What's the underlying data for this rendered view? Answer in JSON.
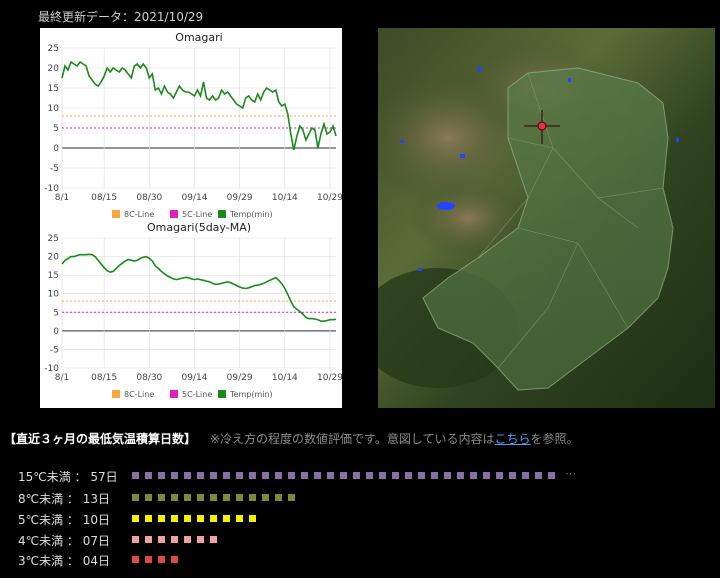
{
  "header": {
    "last_update": "最終更新データ：2021/10/29"
  },
  "colors": {
    "line_8c": "#f5a742",
    "line_5c": "#e020c0",
    "temp": "#1a8a1a",
    "axis_zero": "#555555",
    "grid": "#dddddd",
    "row_15": "#8a6fa5",
    "row_8": "#7a8a35",
    "row_5": "#f2f200",
    "row_4": "#f0a0a0",
    "row_3": "#e04848"
  },
  "chart_data": [
    {
      "type": "line",
      "title": "Omagari",
      "ylim": [
        -10,
        25
      ],
      "yticks": [
        "25",
        "20",
        "15",
        "10",
        "5",
        "0",
        "-5",
        "-10"
      ],
      "xticks": [
        "8/1",
        "08/15",
        "08/30",
        "09/14",
        "09/29",
        "10/14",
        "10/29"
      ],
      "legend": [
        "8C-Line",
        "5C-Line",
        "Temp(min)"
      ],
      "legend_placement": "bottom",
      "reference_lines": [
        {
          "name": "8C-Line",
          "y": 8
        },
        {
          "name": "5C-Line",
          "y": 5
        }
      ],
      "series": [
        {
          "name": "Temp(min)",
          "values": [
            17.5,
            20.5,
            19.5,
            21.5,
            21.0,
            20.5,
            21.5,
            21.0,
            20.5,
            18.0,
            17.0,
            16.0,
            15.5,
            16.5,
            18.0,
            20.0,
            19.0,
            20.0,
            19.5,
            19.0,
            20.0,
            19.5,
            18.5,
            17.5,
            20.5,
            21.0,
            20.0,
            21.0,
            20.0,
            17.5,
            18.5,
            14.5,
            15.0,
            13.5,
            15.5,
            14.0,
            13.5,
            12.5,
            14.0,
            15.5,
            14.5,
            14.0,
            14.0,
            13.5,
            13.0,
            14.5,
            13.0,
            16.5,
            12.5,
            12.0,
            13.0,
            12.0,
            12.5,
            14.5,
            13.5,
            14.0,
            13.0,
            12.0,
            11.0,
            10.5,
            10.0,
            12.5,
            13.0,
            12.0,
            11.5,
            13.5,
            12.0,
            14.0,
            15.0,
            14.5,
            14.0,
            14.5,
            11.5,
            10.5,
            11.0,
            8.5,
            3.5,
            -0.5,
            3.0,
            5.5,
            4.5,
            2.0,
            3.5,
            5.0,
            4.5,
            0.0,
            3.5,
            6.0,
            3.5,
            4.0,
            5.5,
            3.0
          ]
        }
      ]
    },
    {
      "type": "line",
      "title": "Omagari(5day-MA)",
      "ylim": [
        -10,
        25
      ],
      "yticks": [
        "25",
        "20",
        "15",
        "10",
        "5",
        "0",
        "-5",
        "-10"
      ],
      "xticks": [
        "8/1",
        "08/15",
        "08/30",
        "09/14",
        "09/29",
        "10/14",
        "10/29"
      ],
      "legend": [
        "8C-Line",
        "5C-Line",
        "Temp(min)"
      ],
      "legend_placement": "bottom",
      "reference_lines": [
        {
          "name": "8C-Line",
          "y": 8
        },
        {
          "name": "5C-Line",
          "y": 5
        }
      ],
      "series": [
        {
          "name": "Temp(min)",
          "values": [
            18.0,
            19.0,
            19.5,
            20.0,
            20.0,
            20.3,
            20.5,
            20.5,
            20.5,
            20.6,
            20.5,
            20.0,
            19.0,
            18.0,
            17.0,
            16.2,
            15.8,
            16.0,
            16.8,
            17.6,
            18.2,
            18.8,
            19.2,
            19.0,
            18.8,
            19.0,
            19.5,
            19.8,
            20.0,
            19.5,
            18.8,
            17.5,
            16.8,
            16.0,
            15.4,
            14.8,
            14.4,
            14.0,
            13.8,
            14.0,
            14.2,
            14.4,
            14.3,
            14.0,
            13.8,
            14.0,
            13.8,
            13.6,
            13.4,
            13.2,
            12.8,
            12.5,
            12.6,
            12.8,
            13.0,
            13.2,
            13.0,
            12.6,
            12.2,
            11.8,
            11.5,
            11.4,
            11.6,
            11.9,
            12.2,
            12.3,
            12.5,
            12.8,
            13.2,
            13.6,
            14.0,
            14.3,
            13.6,
            12.7,
            11.4,
            9.8,
            8.0,
            6.5,
            5.8,
            5.2,
            4.5,
            3.6,
            3.3,
            3.3,
            3.2,
            3.0,
            2.6,
            2.6,
            2.8,
            3.0,
            3.0,
            3.1
          ]
        }
      ]
    }
  ],
  "section": {
    "title": "【直近３ヶ月の最低気温積算日数】",
    "note_prefix": "※冷え方の程度の数値評価です。意図している内容は",
    "note_link": "こちら",
    "note_suffix": "を参照。"
  },
  "stats": [
    {
      "label": "15℃未満 ： 57日",
      "days": 57,
      "squares_shown": 33,
      "color": "#8a6fa5",
      "overflow": true
    },
    {
      "label": "8℃未満 ： 13日",
      "days": 13,
      "squares_shown": 13,
      "color": "#7a8a35",
      "overflow": false
    },
    {
      "label": "5℃未満 ： 10日",
      "days": 10,
      "squares_shown": 10,
      "color": "#f2f200",
      "overflow": false
    },
    {
      "label": "4℃未満 ： 07日",
      "days": 7,
      "squares_shown": 7,
      "color": "#f0a0a0",
      "overflow": false
    },
    {
      "label": "3℃未満 ： 04日",
      "days": 4,
      "squares_shown": 4,
      "color": "#e04848",
      "overflow": false
    }
  ],
  "overflow_mark": "⋯"
}
